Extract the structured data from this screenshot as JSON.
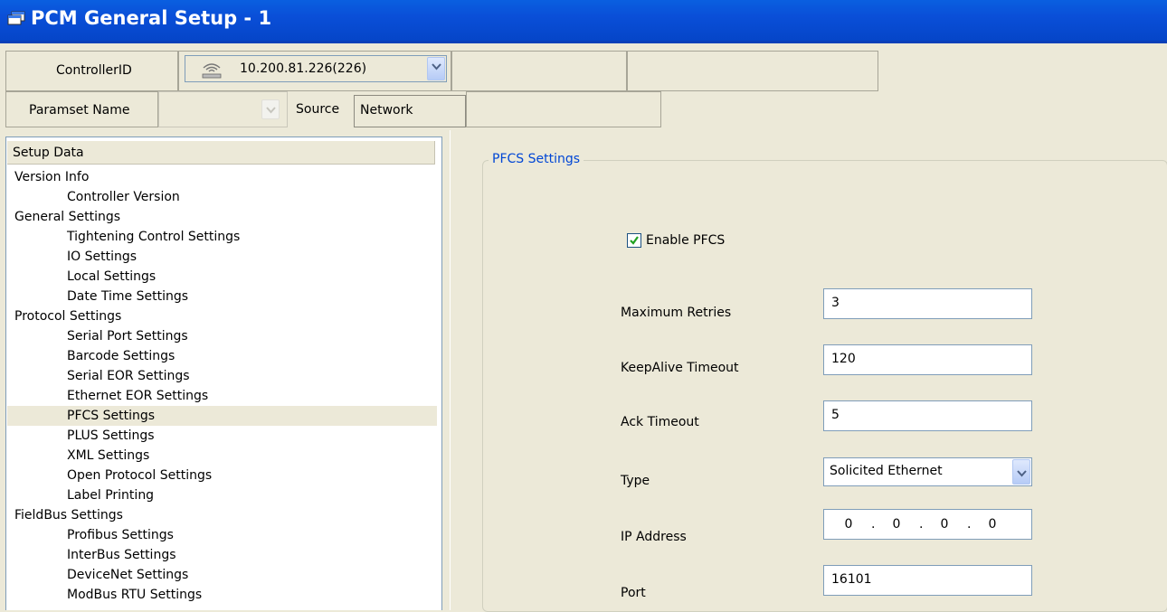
{
  "window": {
    "title": "PCM General Setup - 1"
  },
  "header": {
    "controller_label": "ControllerID",
    "controller_value": "10.200.81.226(226)",
    "paramset_label": "Paramset Name",
    "paramset_value": "",
    "source_label": "Source",
    "source_value": "Network"
  },
  "tree": {
    "header": "Setup Data",
    "items": [
      {
        "label": "Version Info",
        "level": 0
      },
      {
        "label": "Controller Version",
        "level": 1
      },
      {
        "label": "General Settings",
        "level": 0
      },
      {
        "label": "Tightening Control Settings",
        "level": 1
      },
      {
        "label": "IO Settings",
        "level": 1
      },
      {
        "label": "Local Settings",
        "level": 1
      },
      {
        "label": "Date Time Settings",
        "level": 1
      },
      {
        "label": "Protocol Settings",
        "level": 0
      },
      {
        "label": "Serial Port Settings",
        "level": 1
      },
      {
        "label": "Barcode Settings",
        "level": 1
      },
      {
        "label": "Serial EOR Settings",
        "level": 1
      },
      {
        "label": "Ethernet EOR Settings",
        "level": 1
      },
      {
        "label": "PFCS Settings",
        "level": 1,
        "selected": true
      },
      {
        "label": "PLUS Settings",
        "level": 1
      },
      {
        "label": "XML Settings",
        "level": 1
      },
      {
        "label": "Open Protocol Settings",
        "level": 1
      },
      {
        "label": "Label Printing",
        "level": 1
      },
      {
        "label": "FieldBus Settings",
        "level": 0
      },
      {
        "label": "Profibus Settings",
        "level": 1
      },
      {
        "label": "InterBus Settings",
        "level": 1
      },
      {
        "label": "DeviceNet Settings",
        "level": 1
      },
      {
        "label": "ModBus RTU Settings",
        "level": 1
      }
    ]
  },
  "pfcs": {
    "group_title": "PFCS Settings",
    "enable_label": "Enable PFCS",
    "enable_checked": true,
    "max_retries_label": "Maximum Retries",
    "max_retries_value": "3",
    "keepalive_label": "KeepAlive Timeout",
    "keepalive_value": "120",
    "ack_label": "Ack Timeout",
    "ack_value": "5",
    "type_label": "Type",
    "type_value": "Solicited Ethernet",
    "ip_label": "IP Address",
    "ip": [
      "0",
      "0",
      "0",
      "0"
    ],
    "port_label": "Port",
    "port_value": "16101"
  },
  "colors": {
    "titlebar": "#0a4fd8",
    "accent_text": "#0046d5",
    "panel": "#ece9d8"
  }
}
